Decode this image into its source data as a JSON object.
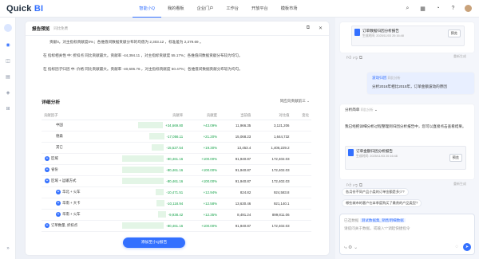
{
  "app": {
    "logo_a": "Quick",
    "logo_b": "BI"
  },
  "nav": [
    "智能小Q",
    "我的看板",
    "企业门户",
    "工作台",
    "开放平台",
    "模板市场"
  ],
  "panel": {
    "title": "报告预览",
    "subtitle": "同比免费"
  },
  "summary": {
    "line1": "贡献0。对主指标贡献度0%；各维值间数据贡献分布的均值为 2,303.12 ，标准差为 2,379.69 。",
    "line2": "在 指标相关性 中: 折扣点 同比贡献最大。贡献率 -44,394.11 ，对主指标贡献度 55.17%；各维值间数据贡献分布较为均匀。",
    "line3": "在 指标因子归因 中: 价格 同比贡献最大。贡献率 -40,606.76 ，对主指标贡献度 50.47%；各维值间数据贡献分布较为均匀。"
  },
  "table": {
    "title": "详细分析",
    "select": "同应向贡献前三",
    "headers": [
      "贡献因子",
      "贡献率",
      "贡献度",
      "当前值",
      "对比值",
      "变化"
    ],
    "rows": [
      {
        "name": "中国",
        "pct": "+34,669.80",
        "share": "+43.09%",
        "cur": "11,966.35",
        "cmp": "3,121,206",
        "w": 0.6,
        "indent": 1,
        "expand": false
      },
      {
        "name": "德森",
        "pct": "-17,056.11",
        "share": "+21.20%",
        "cur": "15,068.23",
        "cmp": "1,644,732",
        "w": 0.35,
        "indent": 1,
        "expand": false
      },
      {
        "name": "其它",
        "pct": "-15,527.54",
        "share": "+19.30%",
        "cur": "13,453.4",
        "cmp": "1,406,229.2",
        "w": 0.3,
        "indent": 1,
        "expand": false
      },
      {
        "name": "区域",
        "pct": "-80,461.16",
        "share": "+100.00%",
        "cur": "91,940.87",
        "cmp": "172,402.03",
        "w": 1,
        "indent": 0,
        "expand": true
      },
      {
        "name": "省份",
        "pct": "-80,461.16",
        "share": "+100.00%",
        "cur": "91,940.87",
        "cmp": "172,402.03",
        "w": 1,
        "indent": 0,
        "expand": true
      },
      {
        "name": "区域 + 运输方式",
        "pct": "-80,461.16",
        "share": "+100.00%",
        "cur": "91,940.87",
        "cmp": "172,402.03",
        "w": 1,
        "indent": 0,
        "expand": true
      },
      {
        "name": "华北 + 火车",
        "pct": "-10,471.51",
        "share": "+12.94%",
        "cur": "824.82",
        "cmp": "924,583.8",
        "w": 0.2,
        "indent": 1,
        "expand": true
      },
      {
        "name": "华南 + 大卡",
        "pct": "-10,118.94",
        "share": "+12.58%",
        "cur": "13,630.46",
        "cmp": "921,140.1",
        "w": 0.19,
        "indent": 1,
        "expand": true
      },
      {
        "name": "华南 + 火车",
        "pct": "-9,938.42",
        "share": "+12.35%",
        "cur": "8,491.24",
        "cmp": "899,811.06",
        "w": 0.19,
        "indent": 1,
        "expand": true
      },
      {
        "name": "订单数量, 折扣点",
        "pct": "-80,461.16",
        "share": "+100.00%",
        "cur": "91,940.87",
        "cmp": "172,402.03",
        "w": 1,
        "indent": 0,
        "expand": true
      }
    ]
  },
  "add_button": "添加至小Q报告",
  "chat": {
    "doc1_title": "订单数据归因分析报告",
    "doc1_sub": "生成时间: 2025/11/03 20:16:48",
    "preview": "预览",
    "ask_label": "波动归因",
    "ask_time": "同比分析",
    "ask_text": "分析2016年相比2015年，订单金额波动的原因",
    "step_label": "分析简单",
    "step_tag": "同比分析",
    "reply": "我已经把详细分析过程整理到归因分析报告中，您可以直接点击查看结果。",
    "doc2_title": "订单金额归因分析报告",
    "doc2_sub": "生成时间: 2025/11/03 20:16:48",
    "retry": "重新生成",
    "q1": "各月份不同产品小类的订单金额是多少?",
    "q2": "哪些城市的客户在本季度购买了最贵的产品类型?",
    "input_prefix": "已选数据",
    "dataset": "测试数据集_销售明细数据",
    "placeholder": "请提问关于数据，或输入\"/\"调起快捷指令"
  }
}
